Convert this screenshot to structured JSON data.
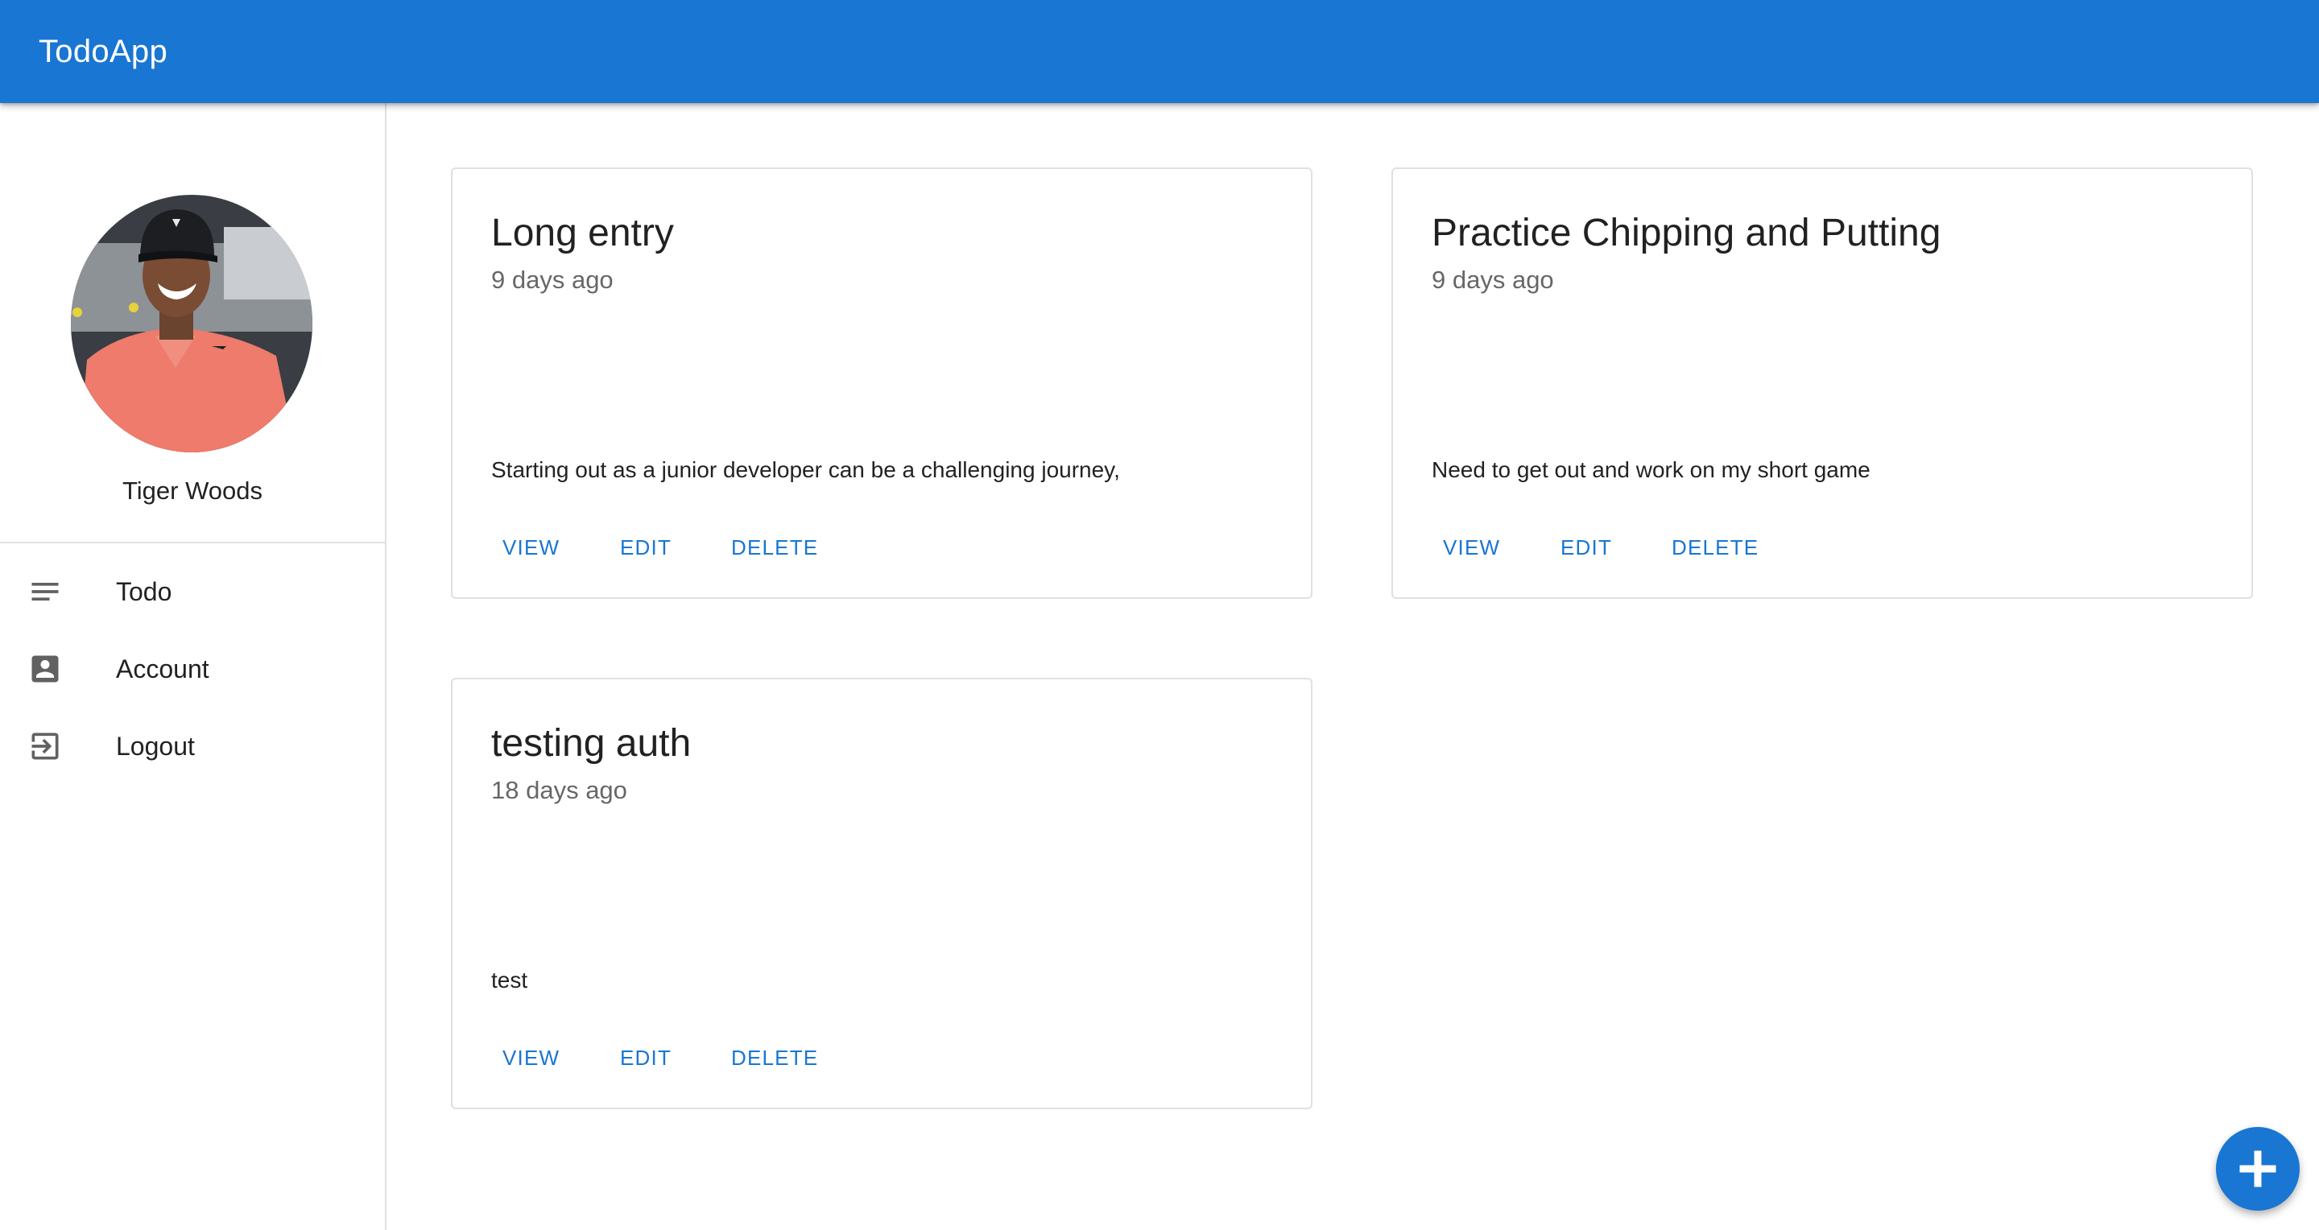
{
  "app": {
    "title": "TodoApp"
  },
  "colors": {
    "primary": "#1976d2",
    "divider": "#e0e0e0"
  },
  "user": {
    "name": "Tiger Woods"
  },
  "nav": [
    {
      "label": "Todo",
      "icon": "notes-icon"
    },
    {
      "label": "Account",
      "icon": "account-box-icon"
    },
    {
      "label": "Logout",
      "icon": "logout-icon"
    }
  ],
  "todos": [
    {
      "title": "Long entry",
      "age": "9 days ago",
      "body": "Starting out as a junior developer can be a challenging journey,",
      "actions": {
        "view": "View",
        "edit": "Edit",
        "delete": "Delete"
      }
    },
    {
      "title": "Practice Chipping and Putting",
      "age": "9 days ago",
      "body": "Need to get out and work on my short game",
      "actions": {
        "view": "View",
        "edit": "Edit",
        "delete": "Delete"
      }
    },
    {
      "title": "testing auth",
      "age": "18 days ago",
      "body": "test",
      "actions": {
        "view": "View",
        "edit": "Edit",
        "delete": "Delete"
      }
    }
  ],
  "fab": {
    "icon": "add-icon"
  }
}
